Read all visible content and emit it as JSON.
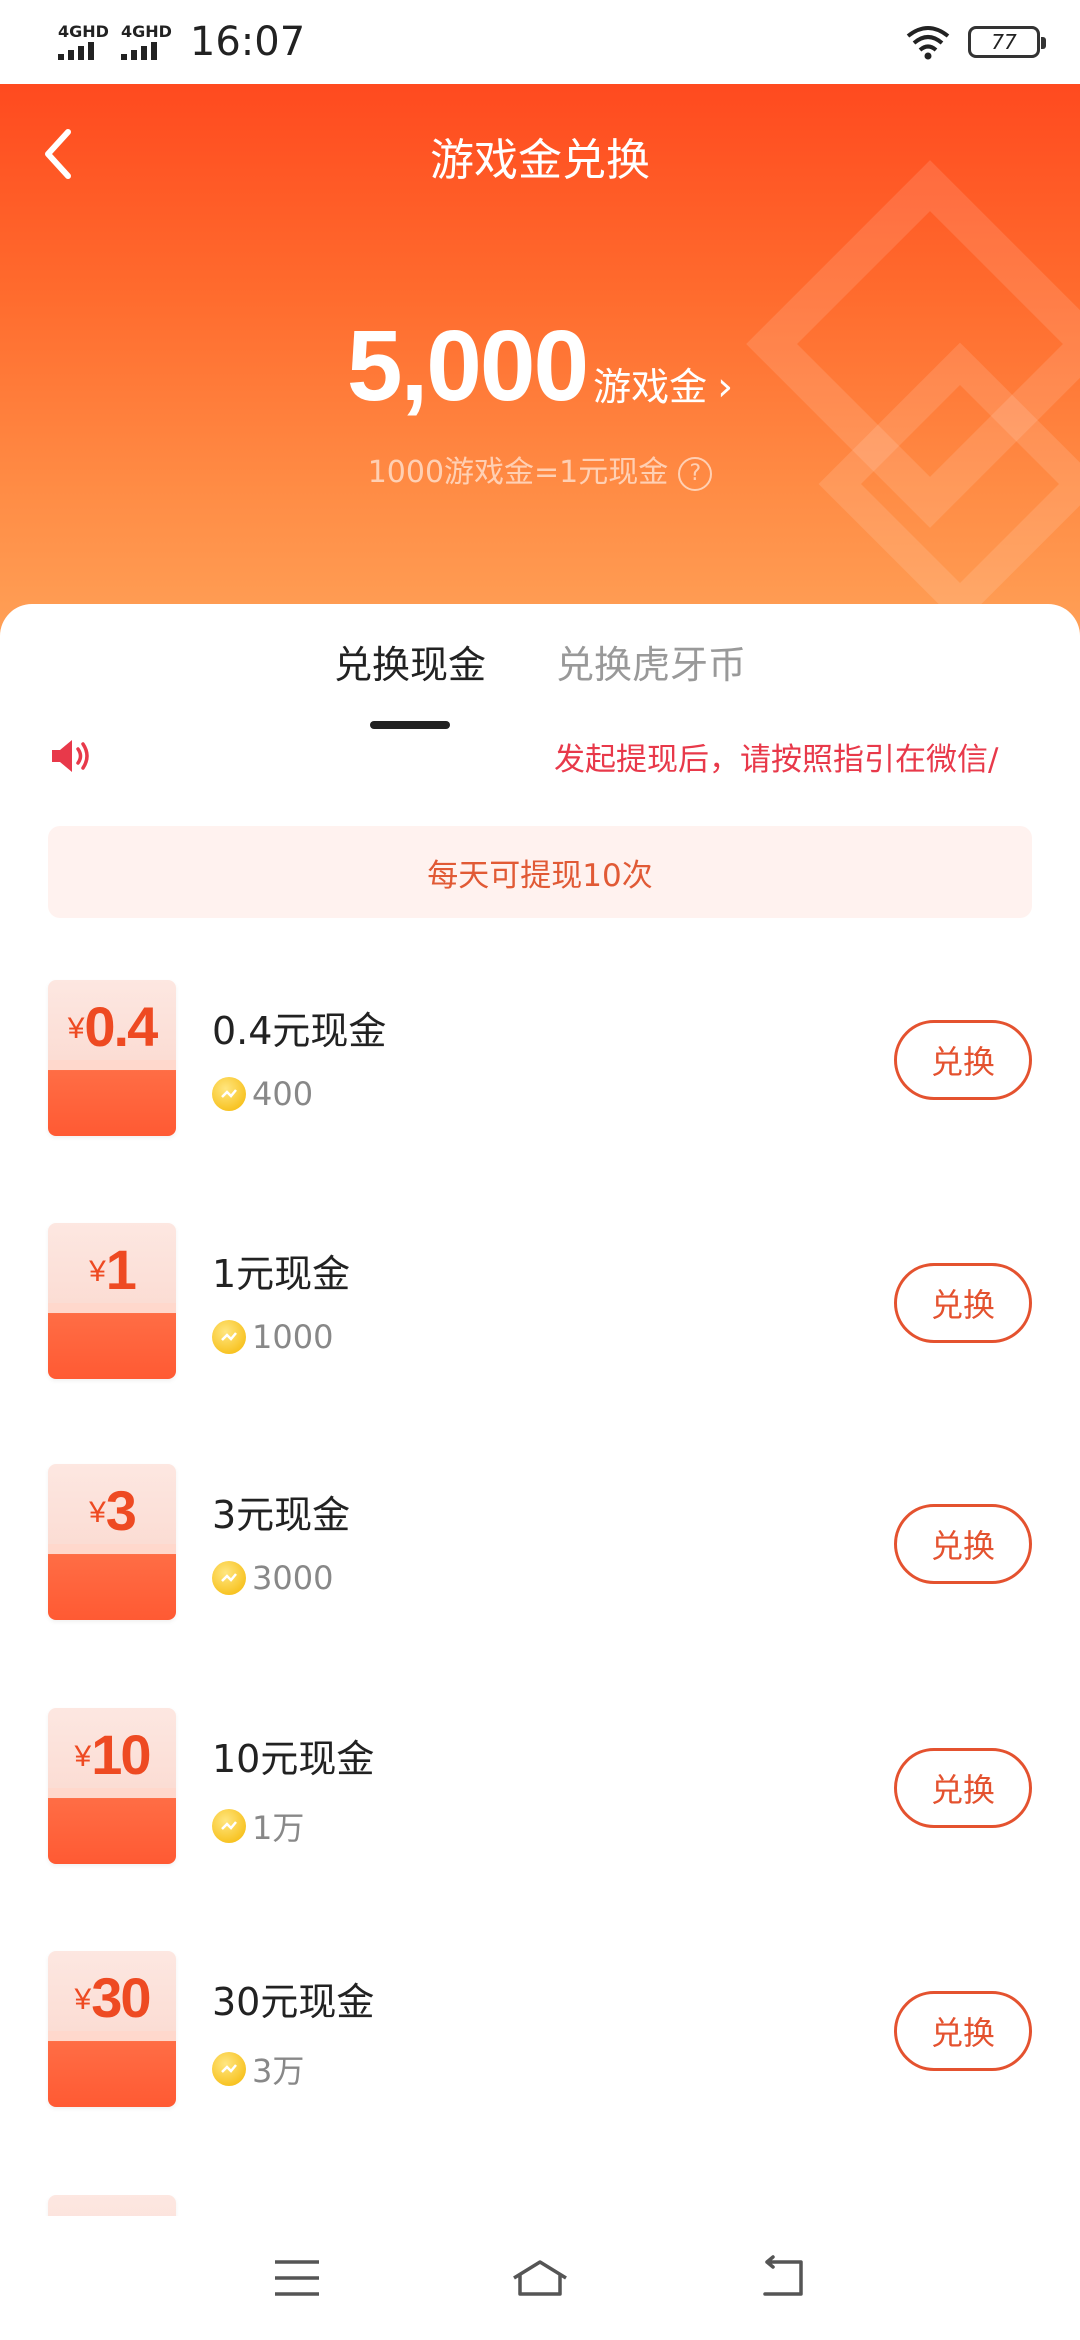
{
  "status_bar": {
    "network1": "4GHD",
    "network2": "4GHD",
    "time": "16:07",
    "battery": "77"
  },
  "header": {
    "title": "游戏金兑换",
    "balance_amount": "5,000",
    "balance_unit": "游戏金",
    "rate_text": "1000游戏金=1元现金",
    "help_icon": "?"
  },
  "tabs": [
    {
      "label": "兑换现金",
      "active": true
    },
    {
      "label": "兑换虎牙币",
      "active": false
    }
  ],
  "notice": {
    "text": "发起提现后，请按照指引在微信/"
  },
  "limit_text": "每天可提现10次",
  "items": [
    {
      "coupon_value": "0.4",
      "name": "0.4元现金",
      "cost": "400",
      "button": "兑换"
    },
    {
      "coupon_value": "1",
      "name": "1元现金",
      "cost": "1000",
      "button": "兑换"
    },
    {
      "coupon_value": "3",
      "name": "3元现金",
      "cost": "3000",
      "button": "兑换"
    },
    {
      "coupon_value": "10",
      "name": "10元现金",
      "cost": "1万",
      "button": "兑换"
    },
    {
      "coupon_value": "30",
      "name": "30元现金",
      "cost": "3万",
      "button": "兑换"
    }
  ],
  "coupon_currency": "¥",
  "colors": {
    "accent": "#e4522f",
    "header_top": "#ff4a1f",
    "notice": "#e8394a"
  }
}
